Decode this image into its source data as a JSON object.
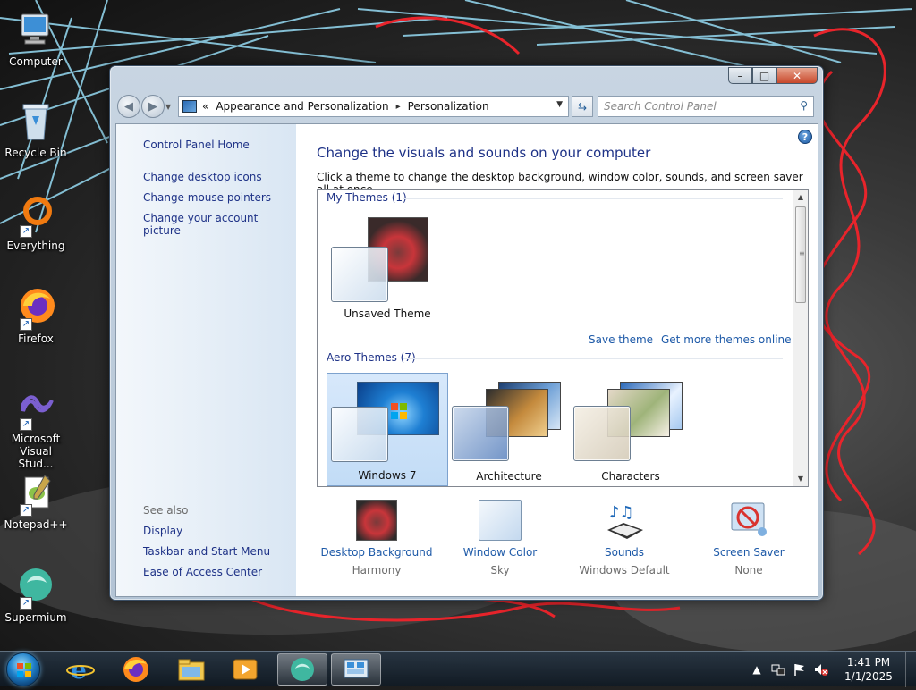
{
  "desktop": {
    "icons": [
      {
        "label": "Computer",
        "icon": "computer-icon"
      },
      {
        "label": "Recycle Bin",
        "icon": "recycle-bin-icon"
      },
      {
        "label": "Everything",
        "icon": "everything-icon"
      },
      {
        "label": "Firefox",
        "icon": "firefox-icon"
      },
      {
        "label": "Microsoft Visual Stud...",
        "icon": "visual-studio-icon"
      },
      {
        "label": "Notepad++",
        "icon": "notepad-plus-plus-icon"
      },
      {
        "label": "Supermium",
        "icon": "supermium-icon"
      }
    ]
  },
  "window": {
    "caption": {
      "minimize": "–",
      "maximize": "□",
      "close": "✕"
    },
    "address": {
      "prefix": "«",
      "crumbs": [
        "Appearance and Personalization",
        "Personalization"
      ],
      "separator": "▸"
    },
    "search": {
      "placeholder": "Search Control Panel"
    },
    "left_pane": {
      "home": "Control Panel Home",
      "links": [
        "Change desktop icons",
        "Change mouse pointers",
        "Change your account picture"
      ],
      "see_also_heading": "See also",
      "see_also": [
        "Display",
        "Taskbar and Start Menu",
        "Ease of Access Center"
      ]
    },
    "main": {
      "heading": "Change the visuals and sounds on your computer",
      "subtext": "Click a theme to change the desktop background, window color, sounds, and screen saver all at once.",
      "my_themes": {
        "label": "My Themes (1)",
        "themes": [
          {
            "name": "Unsaved Theme"
          }
        ]
      },
      "save_theme": "Save theme",
      "get_more": "Get more themes online",
      "aero_themes": {
        "label": "Aero Themes (7)",
        "themes": [
          {
            "name": "Windows 7",
            "selected": true
          },
          {
            "name": "Architecture",
            "selected": false
          },
          {
            "name": "Characters",
            "selected": false
          }
        ]
      },
      "bottom": [
        {
          "label": "Desktop Background",
          "value": "Harmony",
          "icon": "desktop-background-icon"
        },
        {
          "label": "Window Color",
          "value": "Sky",
          "icon": "window-color-icon"
        },
        {
          "label": "Sounds",
          "value": "Windows Default",
          "icon": "sounds-icon"
        },
        {
          "label": "Screen Saver",
          "value": "None",
          "icon": "screen-saver-icon"
        }
      ]
    }
  },
  "taskbar": {
    "pinned": [
      "internet-explorer-icon",
      "firefox-icon",
      "file-explorer-icon",
      "media-player-icon",
      "supermium-icon",
      "control-panel-icon"
    ],
    "clock": {
      "time": "1:41 PM",
      "date": "1/1/2025"
    },
    "tray": [
      "show-hidden-icons-icon",
      "network-icon",
      "action-center-flag-icon",
      "volume-muted-icon"
    ]
  },
  "colors": {
    "link": "#1e3287",
    "accent_link": "#1e5aa8",
    "close_button": "#c7472a"
  }
}
